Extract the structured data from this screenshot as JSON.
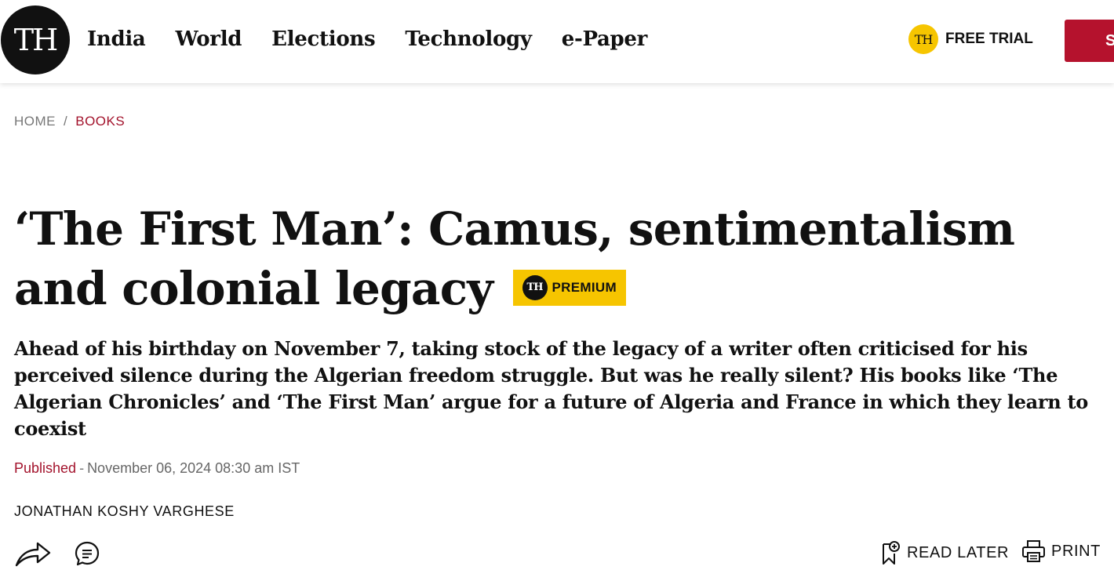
{
  "header": {
    "logo_text": "TH",
    "nav": [
      "India",
      "World",
      "Elections",
      "Technology",
      "e-Paper"
    ],
    "free_trial_badge": "TH",
    "free_trial_label": "FREE TRIAL",
    "subscribe_label": "S"
  },
  "breadcrumb": {
    "home": "HOME",
    "separator": "/",
    "category": "BOOKS"
  },
  "article": {
    "title": "‘The First Man’: Camus, sentimentalism and colonial legacy",
    "premium_logo": "TH",
    "premium_label": "PREMIUM",
    "subtitle": "Ahead of his birthday on November 7, taking stock of the legacy of a writer often criticised for his perceived silence during the Algerian freedom struggle. But was he really silent? His books like ‘The Algerian Chronicles’ and ‘The First Man’ argue for a future of Algeria and France in which they learn to coexist",
    "published_label": "Published",
    "published_sep": "-",
    "published_date": "November 06, 2024 08:30 am IST",
    "author": "JONATHAN KOSHY VARGHESE"
  },
  "actions": {
    "share_icon": "share-icon",
    "comment_icon": "comment-icon",
    "read_later_label": "READ LATER",
    "print_label": "PRINT"
  },
  "colors": {
    "brand_red": "#b5122d",
    "accent_yellow": "#f6c500",
    "link_red": "#a3132c"
  }
}
